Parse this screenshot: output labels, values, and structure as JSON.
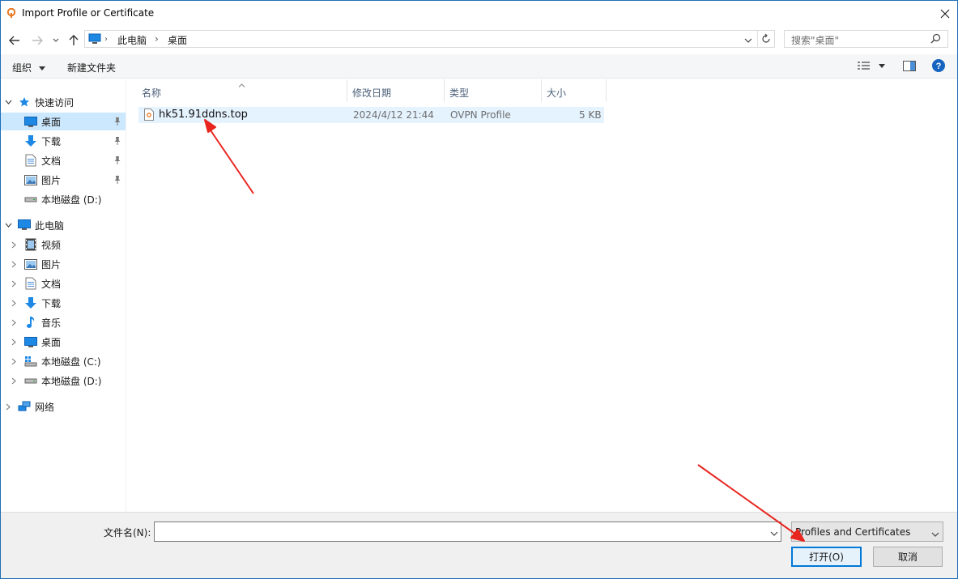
{
  "window": {
    "title": "Import Profile or Certificate"
  },
  "address": {
    "crumbs": [
      "此电脑",
      "桌面"
    ]
  },
  "search": {
    "placeholder": "搜索\"桌面\""
  },
  "toolbar": {
    "organize_label": "组织",
    "new_folder_label": "新建文件夹"
  },
  "navpane": {
    "quick_access": "快速访问",
    "quick_items": [
      {
        "label": "桌面",
        "icon": "desktop-icon",
        "pinned": true,
        "selected": true
      },
      {
        "label": "下载",
        "icon": "download-icon",
        "pinned": true
      },
      {
        "label": "文档",
        "icon": "document-icon",
        "pinned": true
      },
      {
        "label": "图片",
        "icon": "picture-icon",
        "pinned": true
      },
      {
        "label": "本地磁盘 (D:)",
        "icon": "drive-icon"
      }
    ],
    "this_pc": "此电脑",
    "pc_items": [
      {
        "label": "视频",
        "icon": "video-icon"
      },
      {
        "label": "图片",
        "icon": "picture-icon"
      },
      {
        "label": "文档",
        "icon": "document-icon"
      },
      {
        "label": "下载",
        "icon": "download-icon"
      },
      {
        "label": "音乐",
        "icon": "music-icon"
      },
      {
        "label": "桌面",
        "icon": "desktop-icon"
      },
      {
        "label": "本地磁盘 (C:)",
        "icon": "system-drive-icon"
      },
      {
        "label": "本地磁盘 (D:)",
        "icon": "drive-icon"
      }
    ],
    "network": "网络"
  },
  "filelist": {
    "columns": [
      "名称",
      "修改日期",
      "类型",
      "大小"
    ],
    "rows": [
      {
        "name": "hk51.91ddns.top",
        "modified": "2024/4/12 21:44",
        "type": "OVPN Profile",
        "size": "5 KB"
      }
    ]
  },
  "footer": {
    "filename_label": "文件名(N):",
    "filename_value": "",
    "filetype_value": "Profiles and Certificates",
    "open_label": "打开(O)",
    "cancel_label": "取消"
  },
  "colors": {
    "accent": "#0078d7",
    "selection": "#cce8ff",
    "annotation": "#e8251f"
  }
}
